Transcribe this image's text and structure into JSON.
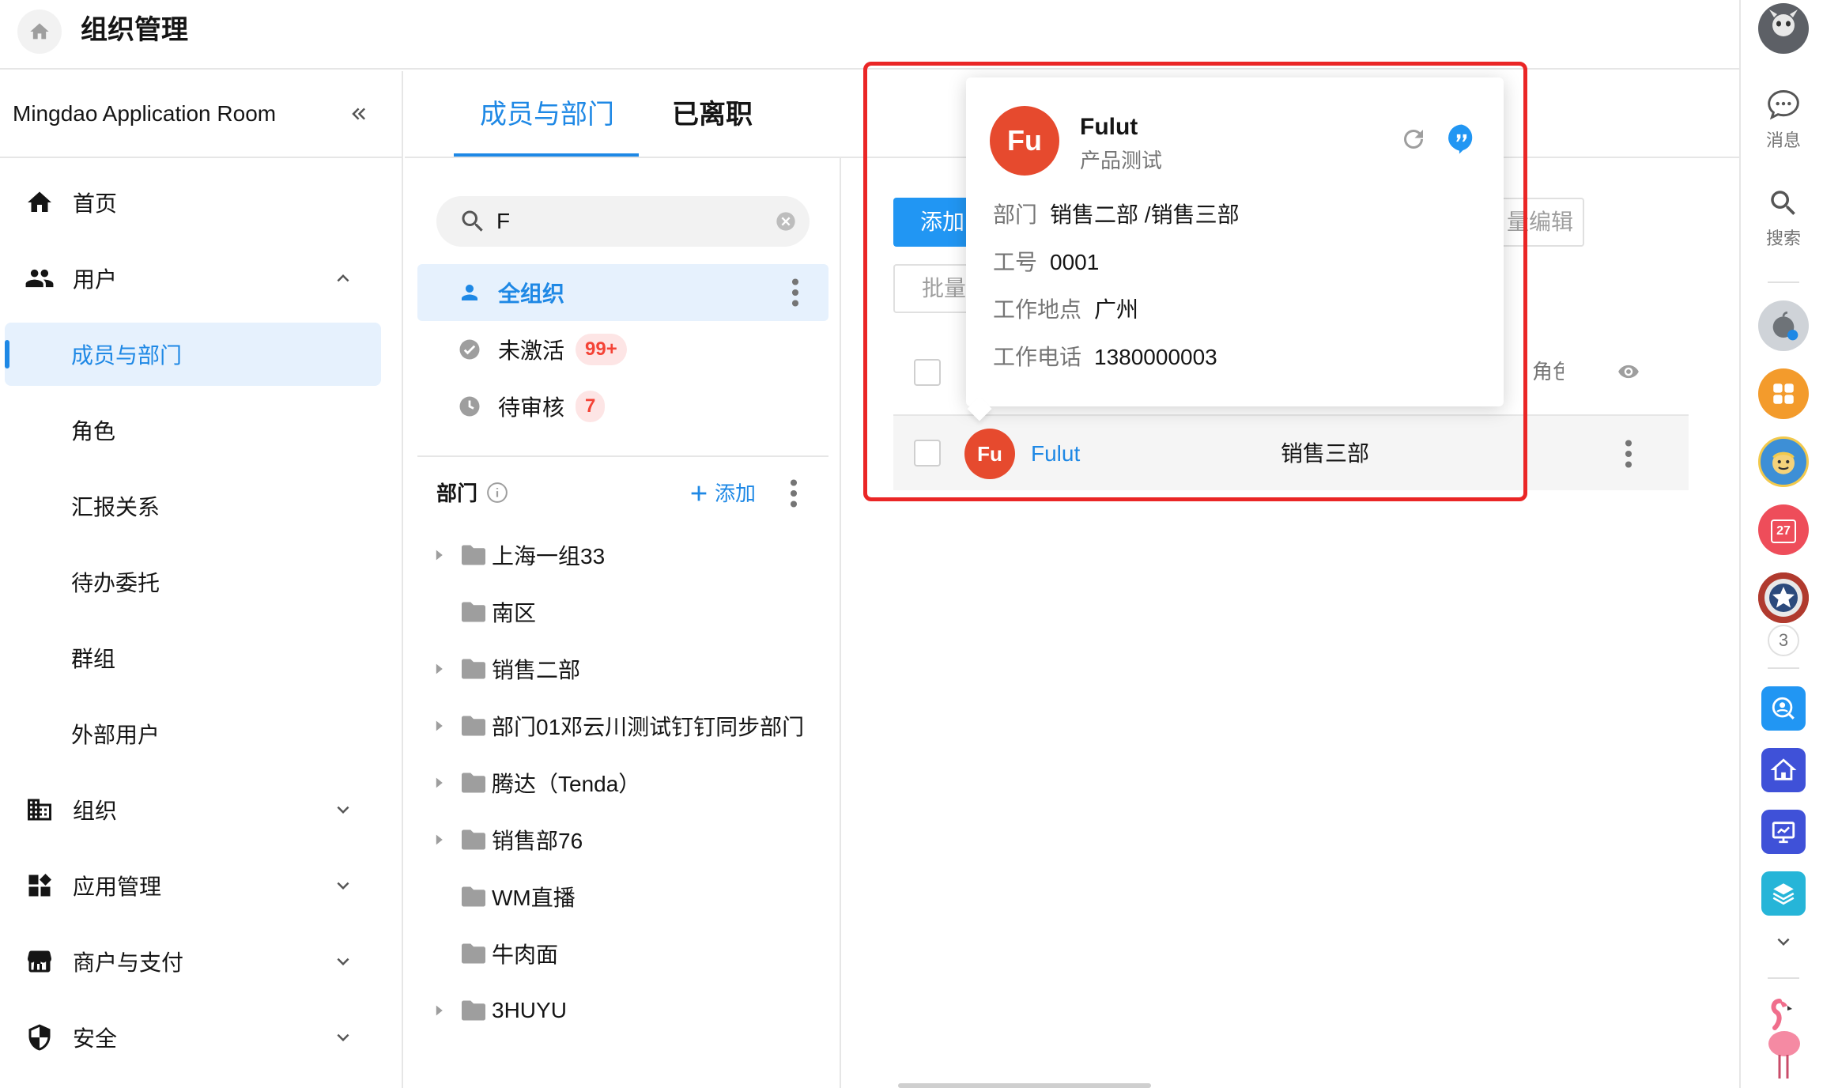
{
  "header": {
    "title": "组织管理"
  },
  "sidebar": {
    "org_name": "Mingdao Application Room",
    "items": [
      {
        "label": "首页"
      },
      {
        "label": "用户"
      },
      {
        "label": "成员与部门"
      },
      {
        "label": "角色"
      },
      {
        "label": "汇报关系"
      },
      {
        "label": "待办委托"
      },
      {
        "label": "群组"
      },
      {
        "label": "外部用户"
      },
      {
        "label": "组织"
      },
      {
        "label": "应用管理"
      },
      {
        "label": "商户与支付"
      },
      {
        "label": "安全"
      }
    ]
  },
  "tabs": [
    {
      "label": "成员与部门"
    },
    {
      "label": "已离职"
    }
  ],
  "search": {
    "value": "F"
  },
  "filters": [
    {
      "label": "全组织"
    },
    {
      "label": "未激活",
      "badge": "99+"
    },
    {
      "label": "待审核",
      "badge": "7"
    }
  ],
  "departments": {
    "title": "部门",
    "add_label": "添加",
    "items": [
      {
        "label": "上海一组33"
      },
      {
        "label": "南区"
      },
      {
        "label": "销售二部"
      },
      {
        "label": "部门01邓云川测试钉钉同步部门"
      },
      {
        "label": "腾达（Tenda）"
      },
      {
        "label": "销售部76"
      },
      {
        "label": "WM直播"
      },
      {
        "label": "牛肉面"
      },
      {
        "label": "3HUYU"
      }
    ]
  },
  "toolbar": {
    "add_label": "添加",
    "batch_label": "批量",
    "batch_edit_label": "量编辑"
  },
  "table": {
    "role_header": "角色",
    "rows": [
      {
        "avatar_text": "Fu",
        "name": "Fulut",
        "dept": "销售三部"
      }
    ]
  },
  "popover": {
    "avatar_text": "Fu",
    "name": "Fulut",
    "job": "产品测试",
    "fields": [
      {
        "key": "部门",
        "value": "销售二部 /销售三部"
      },
      {
        "key": "工号",
        "value": "0001"
      },
      {
        "key": "工作地点",
        "value": "广州"
      },
      {
        "key": "工作电话",
        "value": "1380000003"
      }
    ]
  },
  "rail": {
    "messages_label": "消息",
    "search_label": "搜索",
    "count": "3",
    "calendar_day": "27"
  },
  "colors": {
    "accent": "#1e88e5",
    "highlight": "#ea2626",
    "avatar": "#e64a2e",
    "badge": "#f44336"
  }
}
